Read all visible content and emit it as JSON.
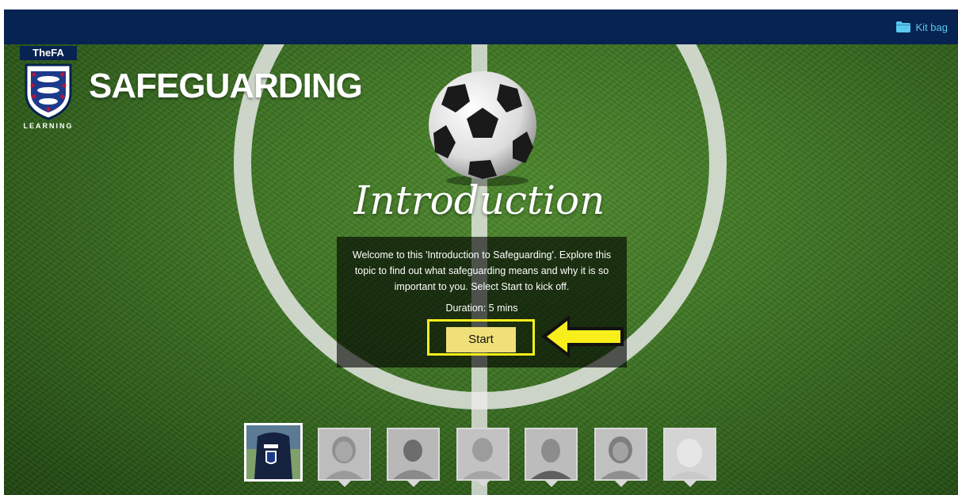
{
  "topbar": {
    "kit_bag_label": "Kit bag",
    "kit_bag_icon": "folder-icon",
    "background": "#062352",
    "accent": "#58c9ef"
  },
  "branding": {
    "logo_text": "TheFA",
    "logo_subtext": "LEARNING",
    "course_title": "SAFEGUARDING"
  },
  "intro": {
    "heading": "Introduction",
    "description": "Welcome to this 'Introduction to Safeguarding'. Explore this topic to find out what safeguarding means and why it is so important to you. Select Start to kick off.",
    "duration": "Duration: 5 mins",
    "start_label": "Start"
  },
  "annotation": {
    "highlight_color": "#f7ee1c",
    "arrow_color": "#f7ee1c"
  },
  "characters": {
    "count": 7,
    "active_index": 0
  }
}
